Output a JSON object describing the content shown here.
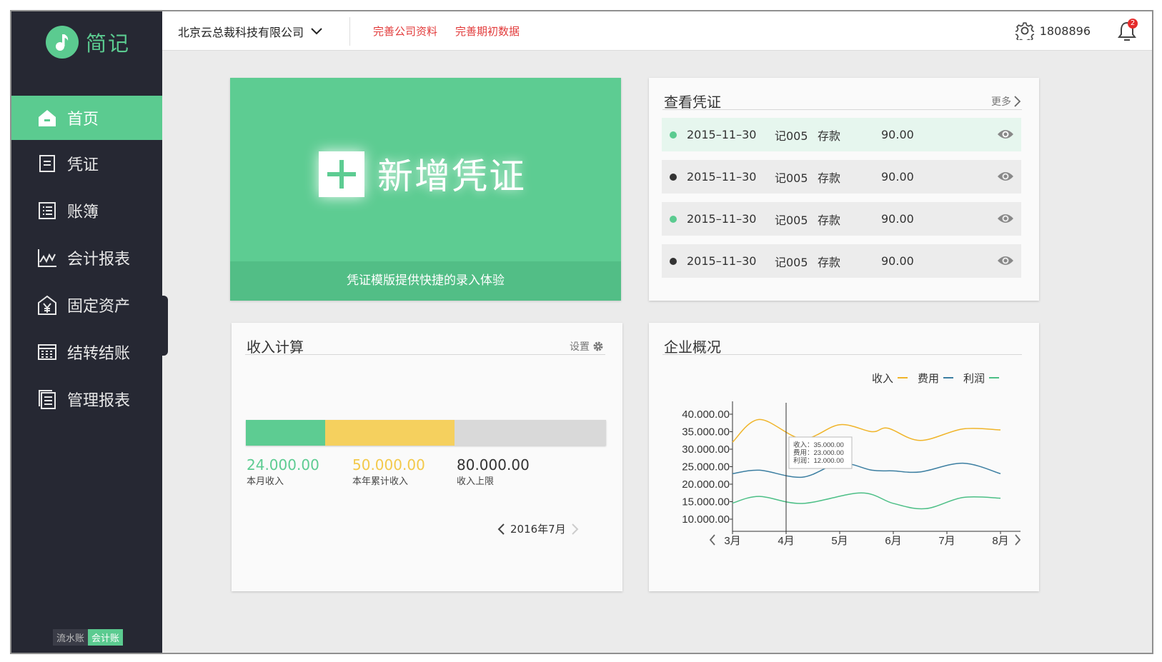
{
  "app": {
    "logo_text": "简记"
  },
  "sidebar": {
    "items": [
      {
        "label": "首页",
        "icon": "home-icon"
      },
      {
        "label": "凭证",
        "icon": "voucher-icon"
      },
      {
        "label": "账簿",
        "icon": "ledger-icon"
      },
      {
        "label": "会计报表",
        "icon": "report-chart-icon"
      },
      {
        "label": "固定资产",
        "icon": "fixed-asset-icon"
      },
      {
        "label": "结转结账",
        "icon": "calculator-icon"
      },
      {
        "label": "管理报表",
        "icon": "document-stack-icon"
      }
    ],
    "active_index": 0,
    "mode_switch": {
      "off": "流水账",
      "on": "会计账"
    }
  },
  "topbar": {
    "company": "北京云总裁科技有限公司",
    "links": [
      "完善公司资料",
      "完善期初数据"
    ],
    "user_id": "1808896",
    "notification_count": "2"
  },
  "new_voucher": {
    "title": "新增凭证",
    "subtitle": "凭证模版提供快捷的录入体验"
  },
  "voucher_panel": {
    "title": "查看凭证",
    "more": "更多",
    "rows": [
      {
        "date": "2015–11–30",
        "code": "记005",
        "type": "存款",
        "amount": "90.00",
        "status": "green"
      },
      {
        "date": "2015–11–30",
        "code": "记005",
        "type": "存款",
        "amount": "90.00",
        "status": "dark"
      },
      {
        "date": "2015–11–30",
        "code": "记005",
        "type": "存款",
        "amount": "90.00",
        "status": "green"
      },
      {
        "date": "2015–11–30",
        "code": "记005",
        "type": "存款",
        "amount": "90.00",
        "status": "dark"
      }
    ]
  },
  "income_panel": {
    "title": "收入计算",
    "settings": "设置",
    "stats": [
      {
        "value": "24.000.00",
        "label": "本月收入"
      },
      {
        "value": "50.000.00",
        "label": "本年累计收入"
      },
      {
        "value": "80.000.00",
        "label": "收入上限"
      }
    ],
    "progress": {
      "month_fraction": 0.22,
      "year_fraction": 0.36
    },
    "month": "2016年7月"
  },
  "overview_panel": {
    "title": "企业概况"
  },
  "colors": {
    "brand_green": "#5bcb90",
    "income": "#f0b429",
    "expense": "#3b7ea1",
    "profit": "#4cbf86",
    "alert_red": "#e23b3b",
    "sidebar_bg": "#262833"
  },
  "chart_data": {
    "type": "line",
    "title": "企业概况",
    "xlabel": "",
    "ylabel": "",
    "categories": [
      "3月",
      "4月",
      "5月",
      "6月",
      "7月",
      "8月"
    ],
    "ylim": [
      10000,
      40000
    ],
    "yticks": [
      "40.000.00",
      "35.000.00",
      "30.000.00",
      "25.000.00",
      "20.000.00",
      "15.000.00",
      "10.000.00"
    ],
    "legend_position": "top-right",
    "series": [
      {
        "name": "收入",
        "color": "#f0b429",
        "points": [
          [
            0,
            32000
          ],
          [
            0.5,
            38500
          ],
          [
            1.3,
            33000
          ],
          [
            2,
            37000
          ],
          [
            2.6,
            35000
          ],
          [
            2.9,
            36000
          ],
          [
            3.5,
            32500
          ],
          [
            4.3,
            35800
          ],
          [
            5.0,
            35500
          ]
        ]
      },
      {
        "name": "费用",
        "color": "#3b7ea1",
        "points": [
          [
            0,
            23000
          ],
          [
            0.5,
            24000
          ],
          [
            1.3,
            22000
          ],
          [
            2,
            26000
          ],
          [
            2.6,
            24000
          ],
          [
            3.0,
            23800
          ],
          [
            3.5,
            23500
          ],
          [
            4.3,
            26000
          ],
          [
            5.0,
            23000
          ]
        ]
      },
      {
        "name": "利润",
        "color": "#4cbf86",
        "points": [
          [
            0,
            14600
          ],
          [
            0.5,
            16500
          ],
          [
            1.3,
            14500
          ],
          [
            2.4,
            17500
          ],
          [
            3.0,
            14500
          ],
          [
            3.6,
            13000
          ],
          [
            4.3,
            16200
          ],
          [
            5.0,
            16000
          ]
        ]
      }
    ],
    "tooltip": {
      "x": 1.0,
      "lines": [
        "收入：35.000.00",
        "费用：23.000.00",
        "利润：12.000.00"
      ]
    }
  }
}
